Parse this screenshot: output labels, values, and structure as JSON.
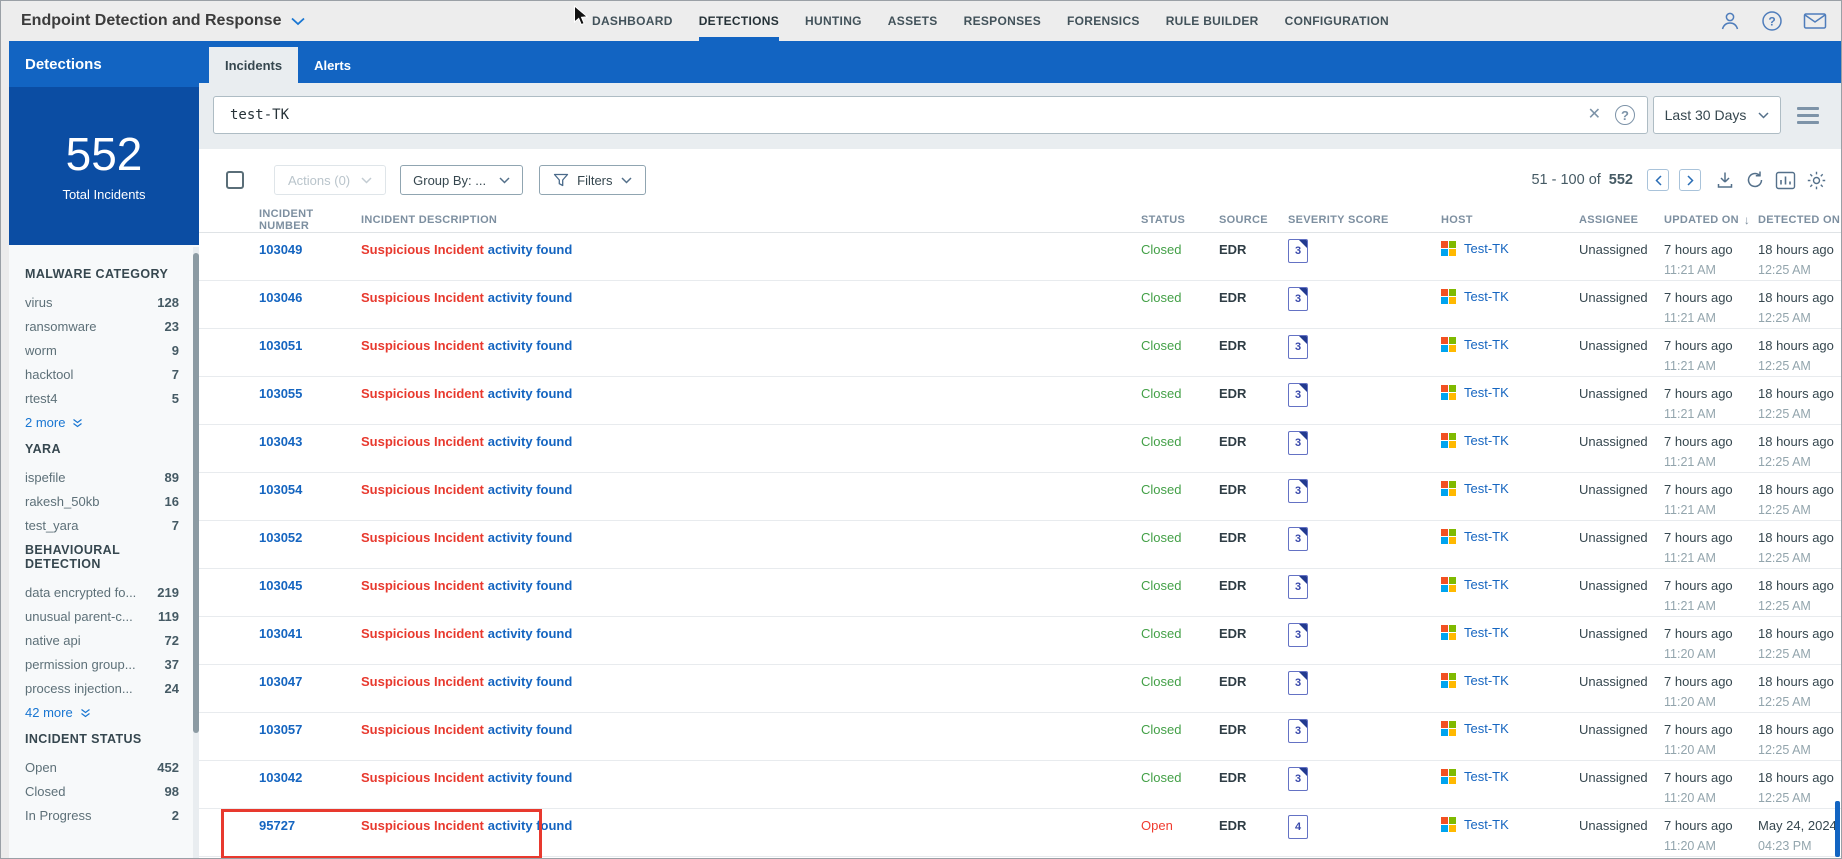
{
  "app": {
    "title": "Endpoint Detection and Response",
    "nav": [
      {
        "label": "DASHBOARD"
      },
      {
        "label": "DETECTIONS",
        "active": true
      },
      {
        "label": "HUNTING"
      },
      {
        "label": "ASSETS"
      },
      {
        "label": "RESPONSES"
      },
      {
        "label": "FORENSICS"
      },
      {
        "label": "RULE BUILDER"
      },
      {
        "label": "CONFIGURATION"
      }
    ]
  },
  "icons": {
    "clear_glyph": "✕",
    "help_glyph": "?",
    "sort_glyph": "↓"
  },
  "sidebar": {
    "title": "Detections",
    "total_count": "552",
    "total_label": "Total Incidents",
    "sections": [
      {
        "title": "MALWARE CATEGORY",
        "items": [
          {
            "label": "virus",
            "count": "128"
          },
          {
            "label": "ransomware",
            "count": "23"
          },
          {
            "label": "worm",
            "count": "9"
          },
          {
            "label": "hacktool",
            "count": "7"
          },
          {
            "label": "rtest4",
            "count": "5"
          }
        ],
        "more": "2 more"
      },
      {
        "title": "YARA",
        "items": [
          {
            "label": "ispefile",
            "count": "89"
          },
          {
            "label": "rakesh_50kb",
            "count": "16"
          },
          {
            "label": "test_yara",
            "count": "7"
          }
        ]
      },
      {
        "title": "BEHAVIOURAL DETECTION",
        "items": [
          {
            "label": "data encrypted fo...",
            "count": "219"
          },
          {
            "label": "unusual parent-c...",
            "count": "119"
          },
          {
            "label": "native api",
            "count": "72"
          },
          {
            "label": "permission group...",
            "count": "37"
          },
          {
            "label": "process injection...",
            "count": "24"
          }
        ],
        "more": "42 more"
      },
      {
        "title": "INCIDENT STATUS",
        "items": [
          {
            "label": "Open",
            "count": "452"
          },
          {
            "label": "Closed",
            "count": "98"
          },
          {
            "label": "In Progress",
            "count": "2"
          }
        ]
      }
    ]
  },
  "tabs": [
    {
      "label": "Incidents",
      "active": true
    },
    {
      "label": "Alerts"
    }
  ],
  "search": {
    "value": "test-TK",
    "time_range": "Last 30 Days"
  },
  "toolbar": {
    "actions": "Actions (0)",
    "group_by": "Group By: ...",
    "filters": "Filters"
  },
  "pagination": {
    "range": "51 - 100 of",
    "total": "552"
  },
  "table": {
    "columns": [
      "INCIDENT NUMBER",
      "INCIDENT DESCRIPTION",
      "STATUS",
      "SOURCE",
      "SEVERITY SCORE",
      "HOST",
      "ASSIGNEE",
      "UPDATED ON",
      "DETECTED ON"
    ],
    "rows": [
      {
        "number": "103049",
        "desc_red": "Suspicious Incident",
        "desc_blue": "activity found",
        "status": "Closed",
        "source": "EDR",
        "severity": "3",
        "fold": true,
        "host": "Test-TK",
        "assignee": "Unassigned",
        "updated_rel": "7 hours ago",
        "updated_time": "11:21 AM",
        "detected_rel": "18 hours ago",
        "detected_time": "12:25 AM"
      },
      {
        "number": "103046",
        "desc_red": "Suspicious Incident",
        "desc_blue": "activity found",
        "status": "Closed",
        "source": "EDR",
        "severity": "3",
        "fold": true,
        "host": "Test-TK",
        "assignee": "Unassigned",
        "updated_rel": "7 hours ago",
        "updated_time": "11:21 AM",
        "detected_rel": "18 hours ago",
        "detected_time": "12:25 AM"
      },
      {
        "number": "103051",
        "desc_red": "Suspicious Incident",
        "desc_blue": "activity found",
        "status": "Closed",
        "source": "EDR",
        "severity": "3",
        "fold": true,
        "host": "Test-TK",
        "assignee": "Unassigned",
        "updated_rel": "7 hours ago",
        "updated_time": "11:21 AM",
        "detected_rel": "18 hours ago",
        "detected_time": "12:25 AM"
      },
      {
        "number": "103055",
        "desc_red": "Suspicious Incident",
        "desc_blue": "activity found",
        "status": "Closed",
        "source": "EDR",
        "severity": "3",
        "fold": true,
        "host": "Test-TK",
        "assignee": "Unassigned",
        "updated_rel": "7 hours ago",
        "updated_time": "11:21 AM",
        "detected_rel": "18 hours ago",
        "detected_time": "12:25 AM"
      },
      {
        "number": "103043",
        "desc_red": "Suspicious Incident",
        "desc_blue": "activity found",
        "status": "Closed",
        "source": "EDR",
        "severity": "3",
        "fold": true,
        "host": "Test-TK",
        "assignee": "Unassigned",
        "updated_rel": "7 hours ago",
        "updated_time": "11:21 AM",
        "detected_rel": "18 hours ago",
        "detected_time": "12:25 AM"
      },
      {
        "number": "103054",
        "desc_red": "Suspicious Incident",
        "desc_blue": "activity found",
        "status": "Closed",
        "source": "EDR",
        "severity": "3",
        "fold": true,
        "host": "Test-TK",
        "assignee": "Unassigned",
        "updated_rel": "7 hours ago",
        "updated_time": "11:21 AM",
        "detected_rel": "18 hours ago",
        "detected_time": "12:25 AM"
      },
      {
        "number": "103052",
        "desc_red": "Suspicious Incident",
        "desc_blue": "activity found",
        "status": "Closed",
        "source": "EDR",
        "severity": "3",
        "fold": true,
        "host": "Test-TK",
        "assignee": "Unassigned",
        "updated_rel": "7 hours ago",
        "updated_time": "11:21 AM",
        "detected_rel": "18 hours ago",
        "detected_time": "12:25 AM"
      },
      {
        "number": "103045",
        "desc_red": "Suspicious Incident",
        "desc_blue": "activity found",
        "status": "Closed",
        "source": "EDR",
        "severity": "3",
        "fold": true,
        "host": "Test-TK",
        "assignee": "Unassigned",
        "updated_rel": "7 hours ago",
        "updated_time": "11:21 AM",
        "detected_rel": "18 hours ago",
        "detected_time": "12:25 AM"
      },
      {
        "number": "103041",
        "desc_red": "Suspicious Incident",
        "desc_blue": "activity found",
        "status": "Closed",
        "source": "EDR",
        "severity": "3",
        "fold": true,
        "host": "Test-TK",
        "assignee": "Unassigned",
        "updated_rel": "7 hours ago",
        "updated_time": "11:20 AM",
        "detected_rel": "18 hours ago",
        "detected_time": "12:25 AM"
      },
      {
        "number": "103047",
        "desc_red": "Suspicious Incident",
        "desc_blue": "activity found",
        "status": "Closed",
        "source": "EDR",
        "severity": "3",
        "fold": true,
        "host": "Test-TK",
        "assignee": "Unassigned",
        "updated_rel": "7 hours ago",
        "updated_time": "11:20 AM",
        "detected_rel": "18 hours ago",
        "detected_time": "12:25 AM"
      },
      {
        "number": "103057",
        "desc_red": "Suspicious Incident",
        "desc_blue": "activity found",
        "status": "Closed",
        "source": "EDR",
        "severity": "3",
        "fold": true,
        "host": "Test-TK",
        "assignee": "Unassigned",
        "updated_rel": "7 hours ago",
        "updated_time": "11:20 AM",
        "detected_rel": "18 hours ago",
        "detected_time": "12:25 AM"
      },
      {
        "number": "103042",
        "desc_red": "Suspicious Incident",
        "desc_blue": "activity found",
        "status": "Closed",
        "source": "EDR",
        "severity": "3",
        "fold": true,
        "host": "Test-TK",
        "assignee": "Unassigned",
        "updated_rel": "7 hours ago",
        "updated_time": "11:20 AM",
        "detected_rel": "18 hours ago",
        "detected_time": "12:25 AM"
      },
      {
        "number": "95727",
        "desc_red": "Suspicious Incident",
        "desc_blue": "activity found",
        "status": "Open",
        "open": true,
        "highlighted": true,
        "source": "EDR",
        "severity": "4",
        "host": "Test-TK",
        "assignee": "Unassigned",
        "updated_rel": "7 hours ago",
        "updated_time": "11:20 AM",
        "detected_rel": "May 24, 2024",
        "detected_time": "04:23 PM"
      }
    ]
  },
  "colors": {
    "primary_blue": "#1264c2",
    "panel_blue": "#0b4da3",
    "link_blue": "#1565c0",
    "alert_red": "#e8392e",
    "status_green": "#43a047",
    "status_red": "#f03b2f"
  }
}
